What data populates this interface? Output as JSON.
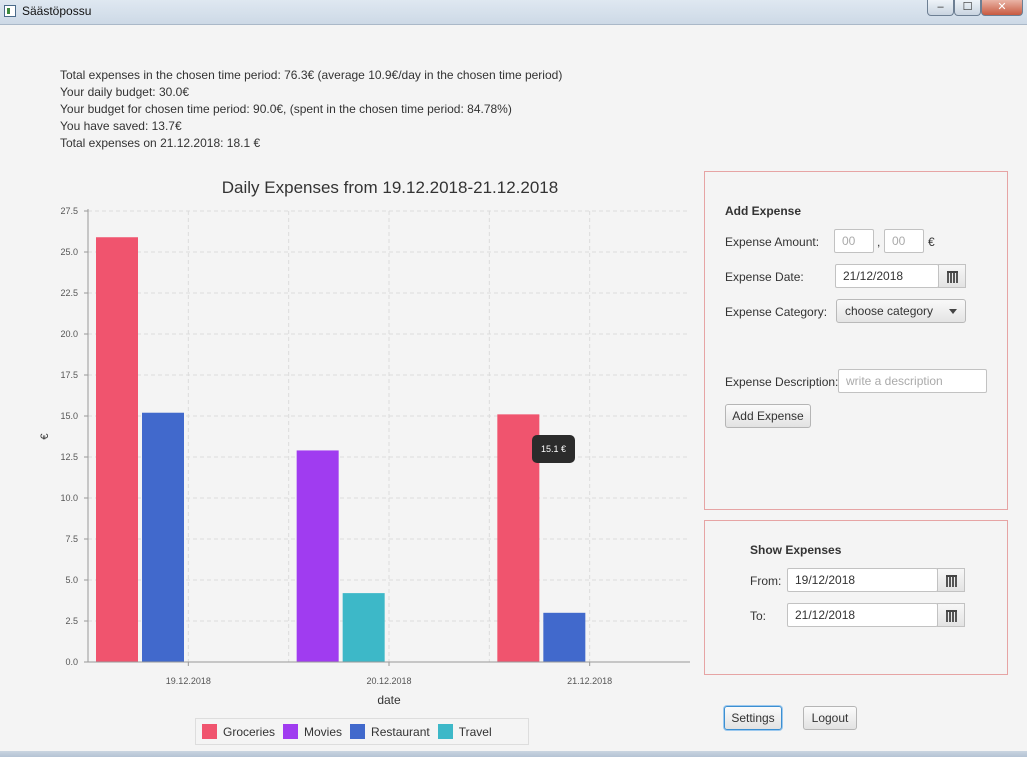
{
  "window": {
    "title": "Säästöpossu",
    "minimize": "–",
    "maximize": "☐",
    "close": "✕"
  },
  "summary": {
    "total_period": "Total expenses in the chosen time period: 76.3€ (average 10.9€/day in the chosen time period)",
    "daily_budget": "Your daily budget: 30.0€",
    "budget_period": "Your budget for chosen time period: 90.0€, (spent in the chosen time period: 84.78%)",
    "saved": "You have saved: 13.7€",
    "total_day": "Total expenses on 21.12.2018: 18.1 €"
  },
  "chart_data": {
    "type": "bar",
    "title": "Daily Expenses from 19.12.2018-21.12.2018",
    "xlabel": "date",
    "ylabel": "€",
    "ylim": [
      0,
      27.5
    ],
    "yticks": [
      "0.0",
      "2.5",
      "5.0",
      "7.5",
      "10.0",
      "12.5",
      "15.0",
      "17.5",
      "20.0",
      "22.5",
      "25.0",
      "27.5"
    ],
    "categories": [
      "19.12.2018",
      "20.12.2018",
      "21.12.2018"
    ],
    "series": [
      {
        "name": "Groceries",
        "color": "#f0546e",
        "values": [
          25.9,
          null,
          15.1
        ]
      },
      {
        "name": "Movies",
        "color": "#a03cf0",
        "values": [
          null,
          12.9,
          null
        ]
      },
      {
        "name": "Restaurant",
        "color": "#4169cc",
        "values": [
          15.2,
          null,
          3.0
        ]
      },
      {
        "name": "Travel",
        "color": "#3db8c8",
        "values": [
          null,
          4.2,
          null
        ]
      }
    ],
    "grid": true,
    "legend": "bottom",
    "tooltip": "15.1 €"
  },
  "add_expense": {
    "heading": "Add Expense",
    "amount_label": "Expense Amount:",
    "amount_whole_placeholder": "00",
    "amount_sep": ",",
    "amount_cents_placeholder": "00",
    "currency": "€",
    "date_label": "Expense Date:",
    "date_value": "21/12/2018",
    "category_label": "Expense Category:",
    "category_value": "choose category",
    "description_label": "Expense Description:",
    "description_placeholder": "write a description",
    "add_button": "Add Expense"
  },
  "show_expenses": {
    "heading": "Show Expenses",
    "from_label": "From:",
    "from_value": "19/12/2018",
    "to_label": "To:",
    "to_value": "21/12/2018"
  },
  "footer": {
    "settings": "Settings",
    "logout": "Logout"
  }
}
